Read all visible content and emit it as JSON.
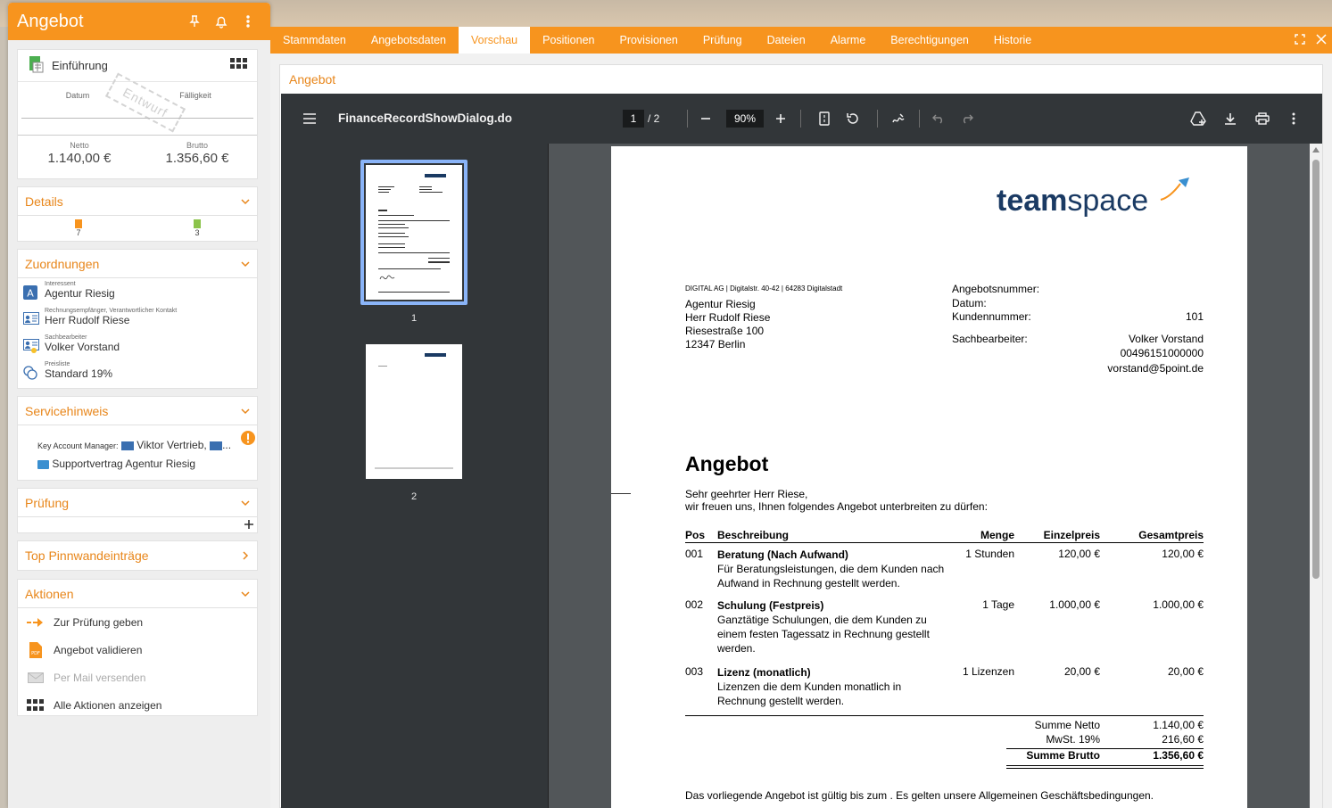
{
  "left": {
    "title": "Angebot",
    "overview": {
      "intro_label": "Einführung",
      "date_label": "Datum",
      "due_label": "Fälligkeit",
      "stamp": "Entwurf",
      "net_label": "Netto",
      "net_value": "1.140,00 €",
      "gross_label": "Brutto",
      "gross_value": "1.356,60 €"
    },
    "details": {
      "title": "Details",
      "count_a": "7",
      "count_b": "3"
    },
    "assignments": {
      "title": "Zuordnungen",
      "items": [
        {
          "caption": "Interessent",
          "value": "Agentur Riesig"
        },
        {
          "caption": "Rechnungsempfänger, Verantwortlicher Kontakt",
          "value": "Herr Rudolf Riese"
        },
        {
          "caption": "Sachbearbeiter",
          "value": "Volker Vorstand"
        },
        {
          "caption": "Preisliste",
          "value": "Standard 19%"
        }
      ]
    },
    "service": {
      "title": "Servicehinweis",
      "kam_label": "Key Account Manager:",
      "kam_value": "Viktor Vertrieb,",
      "ellipsis": "...",
      "contract": "Supportvertrag Agentur Riesig"
    },
    "review": {
      "title": "Prüfung"
    },
    "pinboard": {
      "title": "Top Pinnwandeinträge"
    },
    "actions": {
      "title": "Aktionen",
      "items": [
        {
          "label": "Zur Prüfung geben"
        },
        {
          "label": "Angebot validieren"
        },
        {
          "label": "Per Mail versenden"
        },
        {
          "label": "Alle Aktionen anzeigen"
        }
      ]
    }
  },
  "tabs": [
    "Stammdaten",
    "Angebotsdaten",
    "Vorschau",
    "Positionen",
    "Provisionen",
    "Prüfung",
    "Dateien",
    "Alarme",
    "Berechtigungen",
    "Historie"
  ],
  "active_tab": "Vorschau",
  "content_title": "Angebot",
  "viewer": {
    "filename": "FinanceRecordShowDialog.do",
    "page_current": "1",
    "page_total": "/ 2",
    "zoom": "90%",
    "thumb_labels": [
      "1",
      "2"
    ]
  },
  "document": {
    "logo_a": "team",
    "logo_b": "spa",
    "logo_c": "e",
    "sender_line": "DIGITAL AG | Digitalstr. 40-42 | 64283 Digitalstadt",
    "address": [
      "Agentur Riesig",
      "Herr Rudolf Riese",
      "Riesestraße 100",
      "12347 Berlin"
    ],
    "meta": {
      "offer_no_label": "Angebotsnummer:",
      "date_label": "Datum:",
      "customer_no_label": "Kundennummer:",
      "customer_no": "101",
      "clerk_label": "Sachbearbeiter:",
      "clerk_name": "Volker Vorstand",
      "clerk_phone": "00496151000000",
      "clerk_email": "vorstand@5point.de"
    },
    "title": "Angebot",
    "greeting": "Sehr geehrter Herr Riese,",
    "intro": "wir freuen uns, Ihnen folgendes Angebot unterbreiten zu dürfen:",
    "table_headers": {
      "pos": "Pos",
      "desc": "Beschreibung",
      "qty": "Menge",
      "unit": "Einzelpreis",
      "total": "Gesamtpreis"
    },
    "rows": [
      {
        "pos": "001",
        "name": "Beratung (Nach Aufwand)",
        "lines": [
          "Für Beratungsleistungen, die dem Kunden nach",
          "Aufwand in Rechnung gestellt werden."
        ],
        "qty": "1 Stunden",
        "unit": "120,00 €",
        "total": "120,00 €"
      },
      {
        "pos": "002",
        "name": "Schulung (Festpreis)",
        "lines": [
          "Ganztätige Schulungen, die dem Kunden zu",
          "einem festen Tagessatz in Rechnung gestellt",
          "werden."
        ],
        "qty": "1 Tage",
        "unit": "1.000,00 €",
        "total": "1.000,00 €"
      },
      {
        "pos": "003",
        "name": "Lizenz (monatlich)",
        "lines": [
          "Lizenzen die dem Kunden monatlich in",
          "Rechnung gestellt werden."
        ],
        "qty": "1 Lizenzen",
        "unit": "20,00 €",
        "total": "20,00 €"
      }
    ],
    "totals": {
      "net_label": "Summe Netto",
      "net": "1.140,00 €",
      "vat_label": "MwSt. 19%",
      "vat": "216,60 €",
      "gross_label": "Summe Brutto",
      "gross": "1.356,60 €"
    },
    "validity": "Das vorliegende Angebot ist gültig bis zum . Es gelten unsere Allgemeinen Geschäftsbedingungen."
  },
  "colors": {
    "accent": "#f7941e",
    "accent_text": "#e8861a",
    "viewer_bg": "#525659",
    "viewer_toolbar": "#323639",
    "logo_blue": "#1a3a63"
  }
}
